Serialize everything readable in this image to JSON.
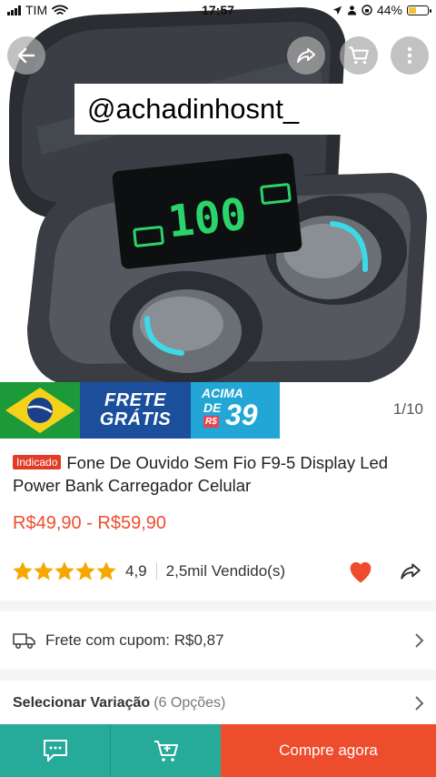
{
  "status_bar": {
    "carrier": "TIM",
    "time": "17:57",
    "battery": "44%",
    "battery_level": 0.44
  },
  "hero": {
    "overlay_handle": "@achadinhosnt_",
    "display_value": "100",
    "page_counter": "1/10"
  },
  "banner": {
    "frete_line1": "FRETE",
    "frete_line2": "GRÁTIS",
    "acima_line1": "ACIMA",
    "acima_line2": "DE",
    "acima_currency": "R$",
    "acima_value": "39"
  },
  "product": {
    "tag": "Indicado",
    "title": "Fone De Ouvido Sem Fio F9-5 Display Led Power Bank Carregador Celular",
    "price": "R$49,90 - R$59,90",
    "rating": "4,9",
    "rating_value": 4.9,
    "sold": "2,5mil Vendido(s)"
  },
  "shipping": {
    "text": "Frete com cupom: R$0,87"
  },
  "variation": {
    "label": "Selecionar Variação",
    "options": "(6 Opções)"
  },
  "bottom_bar": {
    "buy_label": "Compre agora"
  },
  "colors": {
    "accent": "#ee4d2d",
    "teal": "#26aa99",
    "star": "#f6a700",
    "heart": "#ee4d2d"
  },
  "icons": [
    "back-arrow-icon",
    "share-icon",
    "cart-icon",
    "more-icon",
    "star-icon",
    "heart-icon",
    "truck-icon",
    "chevron-right-icon",
    "chat-icon",
    "add-to-cart-icon"
  ]
}
